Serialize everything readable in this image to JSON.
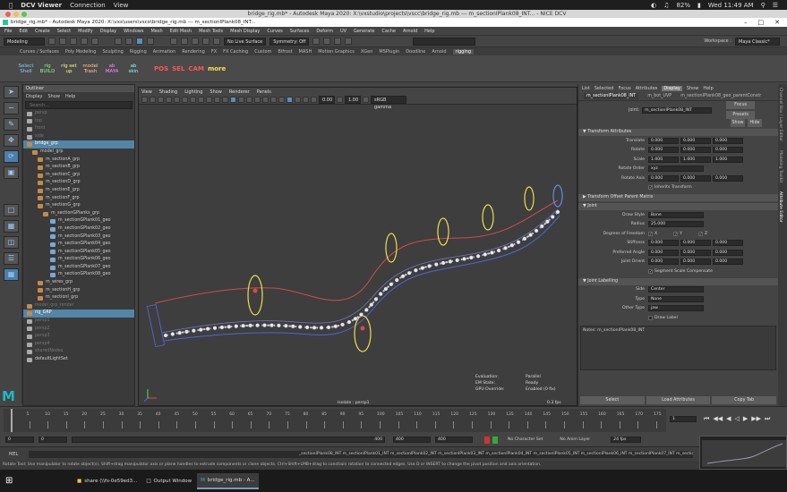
{
  "mac": {
    "app": "DCV Viewer",
    "menu": [
      "Connection",
      "View"
    ],
    "battery": "82%",
    "clock": "Wed 11:49 AM"
  },
  "dcv": {
    "title": "bridge_rig.mb* - Autodesk Maya 2020: X:\\vxstudio\\projects\\vscc\\bridge_rig.mb --- m_sectionIPlank08_INT... - NICE DCV"
  },
  "maya": {
    "title": "bridge_rig.mb* - Autodesk Maya 2020: X:\\vxs\\users\\vsco\\bridge_rig.mb --- m_sectionIPlank08_INT...",
    "menus": [
      "File",
      "Edit",
      "Create",
      "Select",
      "Modify",
      "Display",
      "Windows",
      "Mesh",
      "Edit Mesh",
      "Mesh Tools",
      "Mesh Display",
      "Curves",
      "Surfaces",
      "Deform",
      "UV",
      "Generate",
      "Cache",
      "Arnold",
      "Help"
    ],
    "mode": "Modeling",
    "live": "No Live Surface",
    "symmetry": "Symmetry: Off",
    "workspace_label": "Workspace :",
    "workspace": "Maya Classic*"
  },
  "shelf": {
    "tabs": [
      "Curves / Surfaces",
      "Poly Modeling",
      "Sculpting",
      "Rigging",
      "Animation",
      "Rendering",
      "FX",
      "FX Caching",
      "Custom",
      "Bifrost",
      "MASH",
      "Motion Graphics",
      "XGen",
      "MSPlugin",
      "Doodline",
      "Arnold",
      "rigging"
    ],
    "icons": [
      "Select Shell",
      "rig BUILD",
      "rig set up",
      "model Trash",
      "ab MAYA",
      "ab skin"
    ],
    "labels": [
      "POS",
      "SEL",
      "CAM",
      "more"
    ]
  },
  "outliner": {
    "title": "Outliner",
    "menu": [
      "Display",
      "Show",
      "Help"
    ],
    "search": "Search...",
    "rows": [
      {
        "t": "persp",
        "d": "dim"
      },
      {
        "t": "top",
        "d": "dim"
      },
      {
        "t": "front",
        "d": "dim"
      },
      {
        "t": "side",
        "d": "dim"
      },
      {
        "t": "bridge_grp",
        "d": "hl"
      },
      {
        "t": "model_grp",
        "d": ""
      },
      {
        "t": "m_sectionA_grp",
        "d": ""
      },
      {
        "t": "m_sectionB_grp",
        "d": ""
      },
      {
        "t": "m_sectionC_grp",
        "d": ""
      },
      {
        "t": "m_sectionD_grp",
        "d": ""
      },
      {
        "t": "m_sectionE_grp",
        "d": ""
      },
      {
        "t": "m_sectionF_grp",
        "d": ""
      },
      {
        "t": "m_sectionG_grp",
        "d": ""
      },
      {
        "t": "m_sectionGPlanks_grp",
        "d": ""
      },
      {
        "t": "m_sectionGPlank01_geo",
        "d": ""
      },
      {
        "t": "m_sectionGPlank02_geo",
        "d": ""
      },
      {
        "t": "m_sectionGPlank03_geo",
        "d": ""
      },
      {
        "t": "m_sectionGPlank04_geo",
        "d": ""
      },
      {
        "t": "m_sectionGPlank05_geo",
        "d": ""
      },
      {
        "t": "m_sectionGPlank06_geo",
        "d": ""
      },
      {
        "t": "m_sectionGPlank07_geo",
        "d": ""
      },
      {
        "t": "m_sectionGPlank08_geo",
        "d": ""
      },
      {
        "t": "m_wires_grp",
        "d": ""
      },
      {
        "t": "m_sectionH_grp",
        "d": ""
      },
      {
        "t": "m_sectionI_grp",
        "d": ""
      },
      {
        "t": "model_grp_render",
        "d": "dim"
      },
      {
        "t": "rig_GRP",
        "d": "hl"
      },
      {
        "t": "persp1",
        "d": "dim"
      },
      {
        "t": "persp2",
        "d": "dim"
      },
      {
        "t": "persp3",
        "d": "dim"
      },
      {
        "t": "persp4",
        "d": "dim"
      },
      {
        "t": "sharedNodes",
        "d": "dim"
      },
      {
        "t": "defaultLightSet",
        "d": ""
      }
    ]
  },
  "viewport": {
    "menu": [
      "View",
      "Shading",
      "Lighting",
      "Show",
      "Renderer",
      "Panels"
    ],
    "f1": "0.00",
    "f2": "1.00",
    "gamma": "sRGB gamma",
    "hud_keys": [
      "Evaluation:",
      "EM State:",
      "GPU Override:"
    ],
    "hud_vals": [
      "Parallel",
      "Ready",
      "Enabled (0 fix)"
    ],
    "camera": "Isolate : persp1",
    "fps": "0.3 fps"
  },
  "attr": {
    "tabs": [
      "List",
      "Selected",
      "Focus",
      "Attributes",
      "Display",
      "Show",
      "Help"
    ],
    "tab_active": 4,
    "nodes": [
      "m_sectionIPlank08_INT",
      "m_bot_UVP",
      "m_sectionIPlank08_geo_parentConstr"
    ],
    "joint_label": "joint:",
    "joint_name": "m_sectionIPlank08_INT",
    "btns": [
      "Focus",
      "Presets"
    ],
    "show": "Show",
    "hide": "Hide",
    "sections": [
      "Transform Attributes",
      "Transform Offset Parent Matrix",
      "Joint",
      "Joint Labelling"
    ],
    "rows": [
      {
        "l": "Translate",
        "v": [
          "0.000",
          "0.000",
          "0.000"
        ]
      },
      {
        "l": "Rotate",
        "v": [
          "0.000",
          "0.000",
          "0.000"
        ]
      },
      {
        "l": "Scale",
        "v": [
          "1.000",
          "1.000",
          "1.000"
        ]
      },
      {
        "l": "Rotate Order",
        "v": [
          "xyz"
        ]
      },
      {
        "l": "Rotate Axis",
        "v": [
          "0.000",
          "0.000",
          "0.000"
        ]
      }
    ],
    "inherits": "Inherits Transform",
    "joint_rows": [
      {
        "l": "Draw Style",
        "v": [
          "Bone"
        ]
      },
      {
        "l": "Radius",
        "v": [
          "25.000"
        ]
      },
      {
        "l": "Degrees of Freedom",
        "v": [
          "X",
          "Y",
          "Z"
        ]
      },
      {
        "l": "Stiffness",
        "v": [
          "0.000",
          "0.000",
          "0.000"
        ]
      },
      {
        "l": "Preferred Angle",
        "v": [
          "0.000",
          "0.000",
          "0.000"
        ]
      },
      {
        "l": "Joint Orient",
        "v": [
          "0.000",
          "0.000",
          "0.000"
        ]
      }
    ],
    "seg": "Segment Scale Compensate",
    "label_rows": [
      {
        "l": "Side",
        "v": [
          "Center"
        ]
      },
      {
        "l": "Type",
        "v": [
          "None"
        ]
      },
      {
        "l": "Other Type",
        "v": [
          "jaw"
        ]
      }
    ],
    "draw_label": "Draw Label",
    "notes": "Notes: m_sectionIPlank08_INT",
    "bottom": [
      "Select",
      "Load Attributes",
      "Copy Tab"
    ]
  },
  "side_tabs": [
    "Channel Box / Layer Editor",
    "Modeling Toolkit",
    "Attribute Editor"
  ],
  "timeline": {
    "ticks": [
      "5",
      "10",
      "15",
      "20",
      "25",
      "30",
      "35",
      "40",
      "45",
      "50",
      "55",
      "60",
      "65",
      "70",
      "75",
      "80",
      "85",
      "90",
      "95",
      "100",
      "105",
      "110",
      "115",
      "120",
      "125",
      "130",
      "135",
      "140",
      "145",
      "150",
      "155",
      "160",
      "165",
      "170",
      "175"
    ],
    "frame": "1"
  },
  "range": {
    "start": "0",
    "cur": "0",
    "a": "400",
    "b": "400",
    "c": "400",
    "char": "No Character Set",
    "anim": "No Anim Layer",
    "fps": "24 fps"
  },
  "mel": {
    "label": "MEL",
    "result": "_sectionIPlank08_INT m_sectionIPlank01_INT m_sectionIPlank02_INT m_sectionIPlank03_INT m_sectionIPlank04_INT m_sectionIPlank05_INT m_sectionIPlank06_INT m_sectionIPlank07_INT m_sectionIPlank08_INT"
  },
  "help": "Rotate Tool: Use manipulator to rotate object(s). Shift+drag manipulator axis or plane handles to extrude components or clone objects. Ctrl+Shift+LMB+drag to constrain rotation to connected edges. Use D or INSERT to change the pivot position and axis orientation.",
  "taskbar": [
    "share (\\\\fs-0e59ed3...",
    "Output Window",
    "bridge_rig.mb - A..."
  ],
  "colors": {
    "accent": "#5285a6",
    "rig": "#e8e04a",
    "curve_red": "#d14b4b",
    "curve_blue": "#5562d8"
  }
}
